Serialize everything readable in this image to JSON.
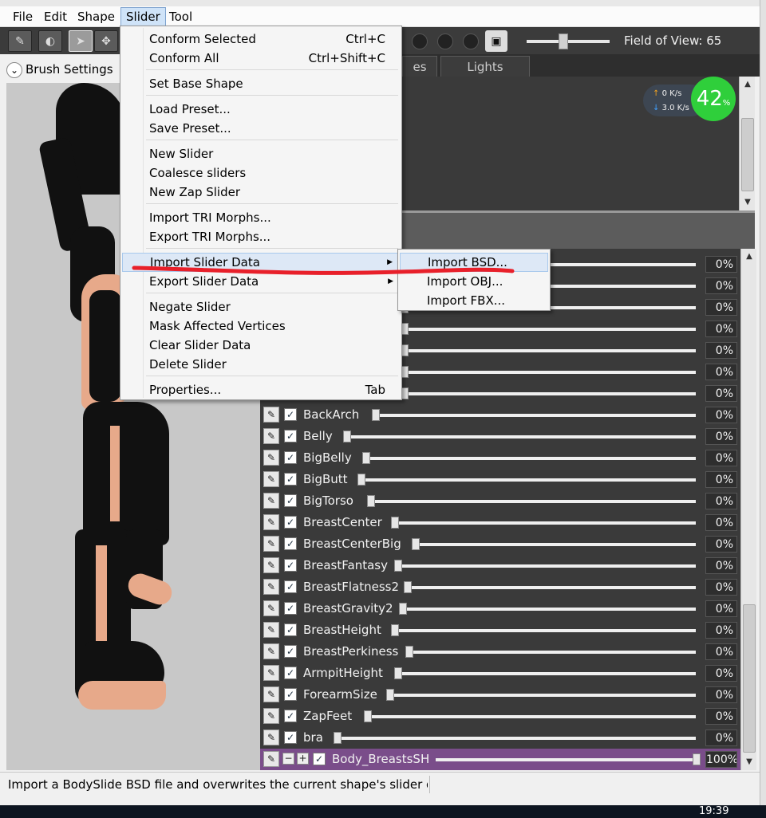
{
  "menubar": {
    "items": [
      {
        "label": "File"
      },
      {
        "label": "Edit"
      },
      {
        "label": "Shape"
      },
      {
        "label": "Slider"
      },
      {
        "label": "Tool"
      }
    ]
  },
  "toolbar": {
    "field_of_view_label": "Field of View: 65",
    "field_of_view_value": 65
  },
  "left_panel": {
    "brush_settings_label": "Brush Settings"
  },
  "tabs": [
    {
      "label": "es"
    },
    {
      "label": "Lights"
    }
  ],
  "net_widget": {
    "upload": "0",
    "upload_unit": "K/s",
    "download": "3.0",
    "download_unit": "K/s",
    "percent": "42",
    "percent_symbol": "%"
  },
  "slider_menu": {
    "items": [
      {
        "label": "Conform Selected",
        "shortcut": "Ctrl+C"
      },
      {
        "label": "Conform All",
        "shortcut": "Ctrl+Shift+C"
      },
      {
        "label": "Set Base Shape"
      },
      {
        "label": "Load Preset..."
      },
      {
        "label": "Save Preset..."
      },
      {
        "label": "New Slider"
      },
      {
        "label": "Coalesce sliders"
      },
      {
        "label": "New Zap Slider"
      },
      {
        "label": "Import TRI Morphs..."
      },
      {
        "label": "Export TRI Morphs..."
      },
      {
        "label": "Import Slider Data"
      },
      {
        "label": "Export Slider Data"
      },
      {
        "label": "Negate Slider"
      },
      {
        "label": "Mask Affected Vertices"
      },
      {
        "label": "Clear Slider Data"
      },
      {
        "label": "Delete Slider"
      },
      {
        "label": "Properties...",
        "shortcut": "Tab"
      }
    ]
  },
  "submenu": {
    "items": [
      {
        "label": "Import BSD..."
      },
      {
        "label": "Import OBJ..."
      },
      {
        "label": "Import FBX..."
      }
    ]
  },
  "sliders": {
    "hidden_rows": [
      {
        "value": "0%",
        "thumb": 0.0
      },
      {
        "value": "0%",
        "thumb": 0.0
      },
      {
        "value": "0%",
        "thumb": 0.0
      },
      {
        "value": "0%",
        "thumb": 0.0
      },
      {
        "value": "0%",
        "thumb": 0.0
      },
      {
        "value": "0%",
        "thumb": 0.0
      },
      {
        "value": "0%",
        "thumb": 0.0
      }
    ],
    "rows": [
      {
        "name": "BackArch",
        "value": "0%"
      },
      {
        "name": "Belly",
        "value": "0%"
      },
      {
        "name": "BigBelly",
        "value": "0%"
      },
      {
        "name": "BigButt",
        "value": "0%"
      },
      {
        "name": "BigTorso",
        "value": "0%"
      },
      {
        "name": "BreastCenter",
        "value": "0%"
      },
      {
        "name": "BreastCenterBig",
        "value": "0%"
      },
      {
        "name": "BreastFantasy",
        "value": "0%"
      },
      {
        "name": "BreastFlatness2",
        "value": "0%"
      },
      {
        "name": "BreastGravity2",
        "value": "0%"
      },
      {
        "name": "BreastHeight",
        "value": "0%"
      },
      {
        "name": "BreastPerkiness",
        "value": "0%"
      },
      {
        "name": "ArmpitHeight",
        "value": "0%"
      },
      {
        "name": "ForearmSize",
        "value": "0%"
      },
      {
        "name": "ZapFeet",
        "value": "0%"
      },
      {
        "name": "bra",
        "value": "0%"
      }
    ],
    "final_row": {
      "name": "Body_BreastsSH",
      "value": "100%",
      "level": 1.0
    }
  },
  "statusbar": {
    "text": "Import a BodySlide BSD file and overwrites the current shape's slider dat"
  },
  "taskbar": {
    "clock": "19:39"
  },
  "colors": {
    "annotation": "#e8202a",
    "final_row_bg": "#7a4d8a",
    "menu_highlight": "#dde8f6"
  }
}
